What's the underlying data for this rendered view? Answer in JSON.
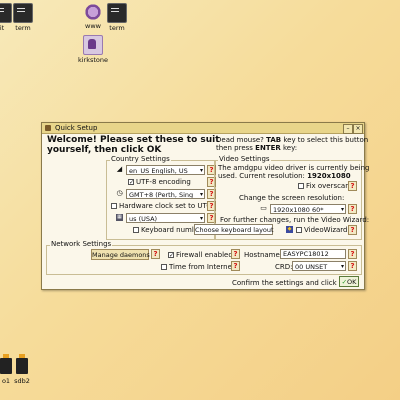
{
  "desktop": {
    "icons": [
      {
        "label": "it"
      },
      {
        "label": "term"
      },
      {
        "label": "www"
      },
      {
        "label": "term"
      },
      {
        "label": "kirkstone"
      },
      {
        "label": "o1"
      },
      {
        "label": "sdb2"
      }
    ]
  },
  "window": {
    "title": "Quick Setup",
    "welcome_line1": "Welcome! Please set these to suit",
    "welcome_line2": "yourself, then click OK",
    "dead_mouse_prefix": "Dead mouse?",
    "dead_mouse_key1": "TAB",
    "dead_mouse_mid": "key to select this button",
    "dead_mouse_line2_prefix": "then press",
    "dead_mouse_key2": "ENTER",
    "dead_mouse_line2_suffix": "key:",
    "country": {
      "section_label": "Country Settings",
      "locale_value": "en_US       English, US",
      "utf8_label": "UTF-8 encoding",
      "utf8_checked": true,
      "timezone_value": "GMT+8   (Perth, Sing",
      "hwclock_label": "Hardware clock set to UTC",
      "hwclock_checked": false,
      "keyboard_value": "us             (USA)",
      "numlock_label": "Keyboard numlock",
      "numlock_checked": false,
      "choose_keyboard_button": "Choose keyboard layout"
    },
    "video": {
      "section_label": "Video Settings",
      "line1": "The amdgpu video driver is currently being",
      "line2_prefix": "used. Current resolution:",
      "resolution_current": "1920x1080",
      "fix_overscan_label": "Fix overscan",
      "fix_overscan_checked": false,
      "change_resolution_label": "Change the screen resolution:",
      "resolution_value": "1920x1080    60*",
      "wizard_hint": "For further changes, run the Video Wizard:",
      "video_wizard_label": "VideoWizard"
    },
    "network": {
      "section_label": "Network Settings",
      "manage_daemons_button": "Manage daemons",
      "firewall_label": "Firewall enabled",
      "firewall_checked": true,
      "hostname_label": "Hostname:",
      "hostname_value": "EASYPC18012",
      "time_internet_label": "Time from Internet",
      "time_internet_checked": false,
      "crd_label": "CRD:",
      "crd_value": "00 UNSET"
    },
    "question_mark": "?",
    "confirm_label": "Confirm the settings and click OK:",
    "ok_button": "OK"
  }
}
